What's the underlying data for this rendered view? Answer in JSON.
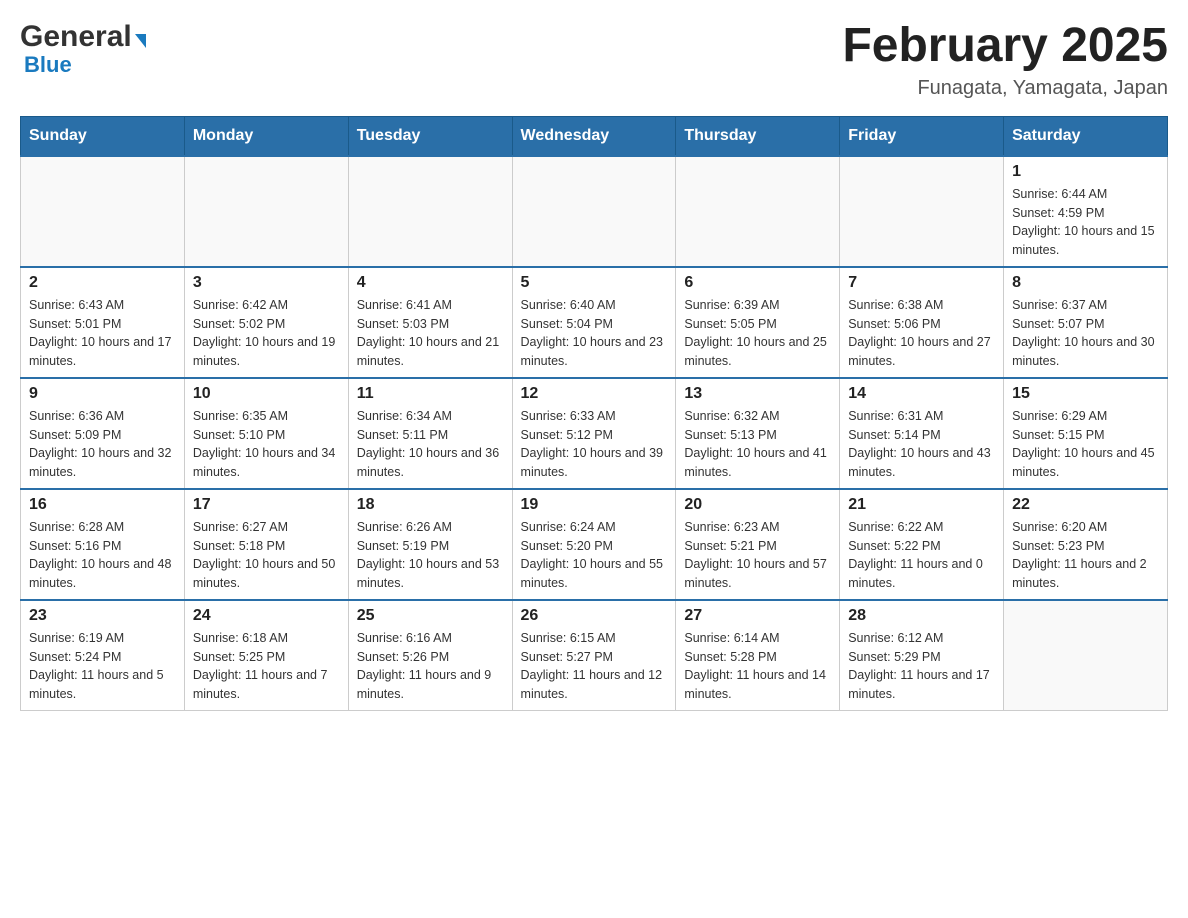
{
  "header": {
    "logo_general": "General",
    "logo_blue": "Blue",
    "month_title": "February 2025",
    "location": "Funagata, Yamagata, Japan"
  },
  "weekdays": [
    "Sunday",
    "Monday",
    "Tuesday",
    "Wednesday",
    "Thursday",
    "Friday",
    "Saturday"
  ],
  "weeks": [
    [
      {
        "day": "",
        "info": ""
      },
      {
        "day": "",
        "info": ""
      },
      {
        "day": "",
        "info": ""
      },
      {
        "day": "",
        "info": ""
      },
      {
        "day": "",
        "info": ""
      },
      {
        "day": "",
        "info": ""
      },
      {
        "day": "1",
        "info": "Sunrise: 6:44 AM\nSunset: 4:59 PM\nDaylight: 10 hours and 15 minutes."
      }
    ],
    [
      {
        "day": "2",
        "info": "Sunrise: 6:43 AM\nSunset: 5:01 PM\nDaylight: 10 hours and 17 minutes."
      },
      {
        "day": "3",
        "info": "Sunrise: 6:42 AM\nSunset: 5:02 PM\nDaylight: 10 hours and 19 minutes."
      },
      {
        "day": "4",
        "info": "Sunrise: 6:41 AM\nSunset: 5:03 PM\nDaylight: 10 hours and 21 minutes."
      },
      {
        "day": "5",
        "info": "Sunrise: 6:40 AM\nSunset: 5:04 PM\nDaylight: 10 hours and 23 minutes."
      },
      {
        "day": "6",
        "info": "Sunrise: 6:39 AM\nSunset: 5:05 PM\nDaylight: 10 hours and 25 minutes."
      },
      {
        "day": "7",
        "info": "Sunrise: 6:38 AM\nSunset: 5:06 PM\nDaylight: 10 hours and 27 minutes."
      },
      {
        "day": "8",
        "info": "Sunrise: 6:37 AM\nSunset: 5:07 PM\nDaylight: 10 hours and 30 minutes."
      }
    ],
    [
      {
        "day": "9",
        "info": "Sunrise: 6:36 AM\nSunset: 5:09 PM\nDaylight: 10 hours and 32 minutes."
      },
      {
        "day": "10",
        "info": "Sunrise: 6:35 AM\nSunset: 5:10 PM\nDaylight: 10 hours and 34 minutes."
      },
      {
        "day": "11",
        "info": "Sunrise: 6:34 AM\nSunset: 5:11 PM\nDaylight: 10 hours and 36 minutes."
      },
      {
        "day": "12",
        "info": "Sunrise: 6:33 AM\nSunset: 5:12 PM\nDaylight: 10 hours and 39 minutes."
      },
      {
        "day": "13",
        "info": "Sunrise: 6:32 AM\nSunset: 5:13 PM\nDaylight: 10 hours and 41 minutes."
      },
      {
        "day": "14",
        "info": "Sunrise: 6:31 AM\nSunset: 5:14 PM\nDaylight: 10 hours and 43 minutes."
      },
      {
        "day": "15",
        "info": "Sunrise: 6:29 AM\nSunset: 5:15 PM\nDaylight: 10 hours and 45 minutes."
      }
    ],
    [
      {
        "day": "16",
        "info": "Sunrise: 6:28 AM\nSunset: 5:16 PM\nDaylight: 10 hours and 48 minutes."
      },
      {
        "day": "17",
        "info": "Sunrise: 6:27 AM\nSunset: 5:18 PM\nDaylight: 10 hours and 50 minutes."
      },
      {
        "day": "18",
        "info": "Sunrise: 6:26 AM\nSunset: 5:19 PM\nDaylight: 10 hours and 53 minutes."
      },
      {
        "day": "19",
        "info": "Sunrise: 6:24 AM\nSunset: 5:20 PM\nDaylight: 10 hours and 55 minutes."
      },
      {
        "day": "20",
        "info": "Sunrise: 6:23 AM\nSunset: 5:21 PM\nDaylight: 10 hours and 57 minutes."
      },
      {
        "day": "21",
        "info": "Sunrise: 6:22 AM\nSunset: 5:22 PM\nDaylight: 11 hours and 0 minutes."
      },
      {
        "day": "22",
        "info": "Sunrise: 6:20 AM\nSunset: 5:23 PM\nDaylight: 11 hours and 2 minutes."
      }
    ],
    [
      {
        "day": "23",
        "info": "Sunrise: 6:19 AM\nSunset: 5:24 PM\nDaylight: 11 hours and 5 minutes."
      },
      {
        "day": "24",
        "info": "Sunrise: 6:18 AM\nSunset: 5:25 PM\nDaylight: 11 hours and 7 minutes."
      },
      {
        "day": "25",
        "info": "Sunrise: 6:16 AM\nSunset: 5:26 PM\nDaylight: 11 hours and 9 minutes."
      },
      {
        "day": "26",
        "info": "Sunrise: 6:15 AM\nSunset: 5:27 PM\nDaylight: 11 hours and 12 minutes."
      },
      {
        "day": "27",
        "info": "Sunrise: 6:14 AM\nSunset: 5:28 PM\nDaylight: 11 hours and 14 minutes."
      },
      {
        "day": "28",
        "info": "Sunrise: 6:12 AM\nSunset: 5:29 PM\nDaylight: 11 hours and 17 minutes."
      },
      {
        "day": "",
        "info": ""
      }
    ]
  ]
}
